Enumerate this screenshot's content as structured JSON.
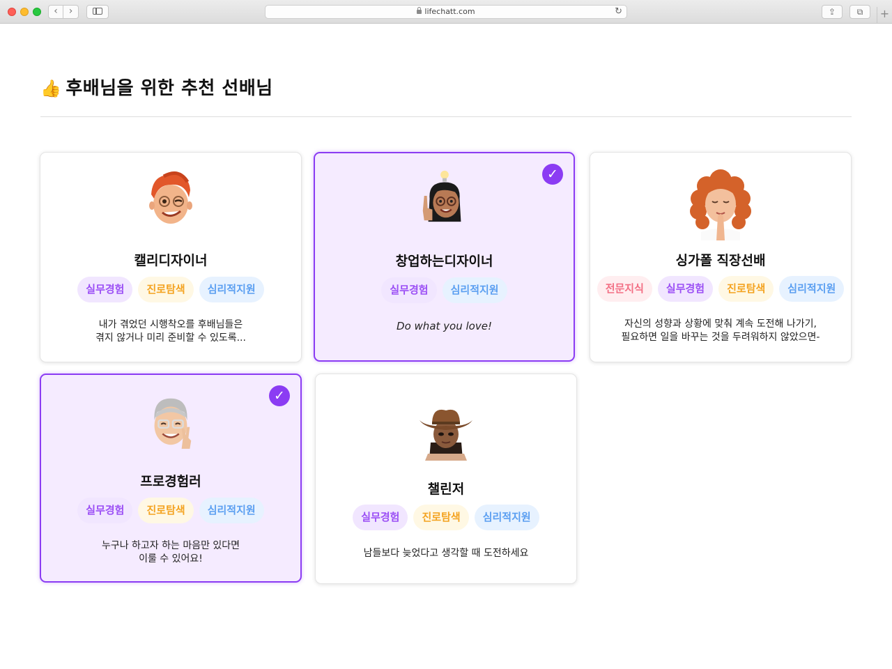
{
  "browser": {
    "url": "lifechatt.com",
    "icons": {
      "back": "chevron-left-icon",
      "forward": "chevron-right-icon",
      "sidebar": "sidebar-icon",
      "lock": "lock-icon",
      "reload": "reload-icon",
      "share": "share-icon",
      "tabs": "tabs-icon",
      "new_tab": "plus-icon"
    }
  },
  "page": {
    "title_emoji": "👍",
    "title": "후배님을 위한 추천 선배님"
  },
  "colors": {
    "accent": "#8b3cf3",
    "selected_bg": "#f5ebff",
    "tag_experience": "#9b4ff5",
    "tag_career": "#f4a321",
    "tag_mind": "#5b9ff1",
    "tag_expertise": "#f36f84"
  },
  "cards": [
    {
      "name": "캘리디자이너",
      "selected": false,
      "avatar": "memoji-red-hair-wink",
      "tags": [
        "실무경험",
        "진로탐색",
        "심리적지원"
      ],
      "desc_line1": "내가 겪었던 시행착오를 후배님들은",
      "desc_line2": "겪지 않거나 미리 준비할 수 있도록..."
    },
    {
      "name": "창업하는디자이너",
      "selected": true,
      "avatar": "memoji-lightbulb-idea",
      "tags": [
        "실무경험",
        "심리적지원"
      ],
      "desc_line1": "Do what you love!"
    },
    {
      "name": "싱가폴 직장선배",
      "selected": false,
      "avatar": "memoji-curly-hair-praying",
      "tags": [
        "전문지식",
        "실무경험",
        "진로탐색",
        "심리적지원"
      ],
      "desc_line1": "자신의 성향과 상황에 맞춰 계속 도전해 나가기,",
      "desc_line2": "필요하면 일을 바꾸는 것을 두려워하지 않았으면-"
    },
    {
      "name": "프로경험러",
      "selected": true,
      "avatar": "memoji-gray-hair-peace",
      "tags": [
        "실무경험",
        "진로탐색",
        "심리적지원"
      ],
      "desc_line1": "누구나 하고자 하는 마음만 있다면",
      "desc_line2": "이룰 수 있어요!"
    },
    {
      "name": "챌린저",
      "selected": false,
      "avatar": "memoji-cowboy-hat",
      "tags": [
        "실무경험",
        "진로탐색",
        "심리적지원"
      ],
      "desc_line1": "남들보다 늦었다고 생각할 때 도전하세요"
    }
  ]
}
